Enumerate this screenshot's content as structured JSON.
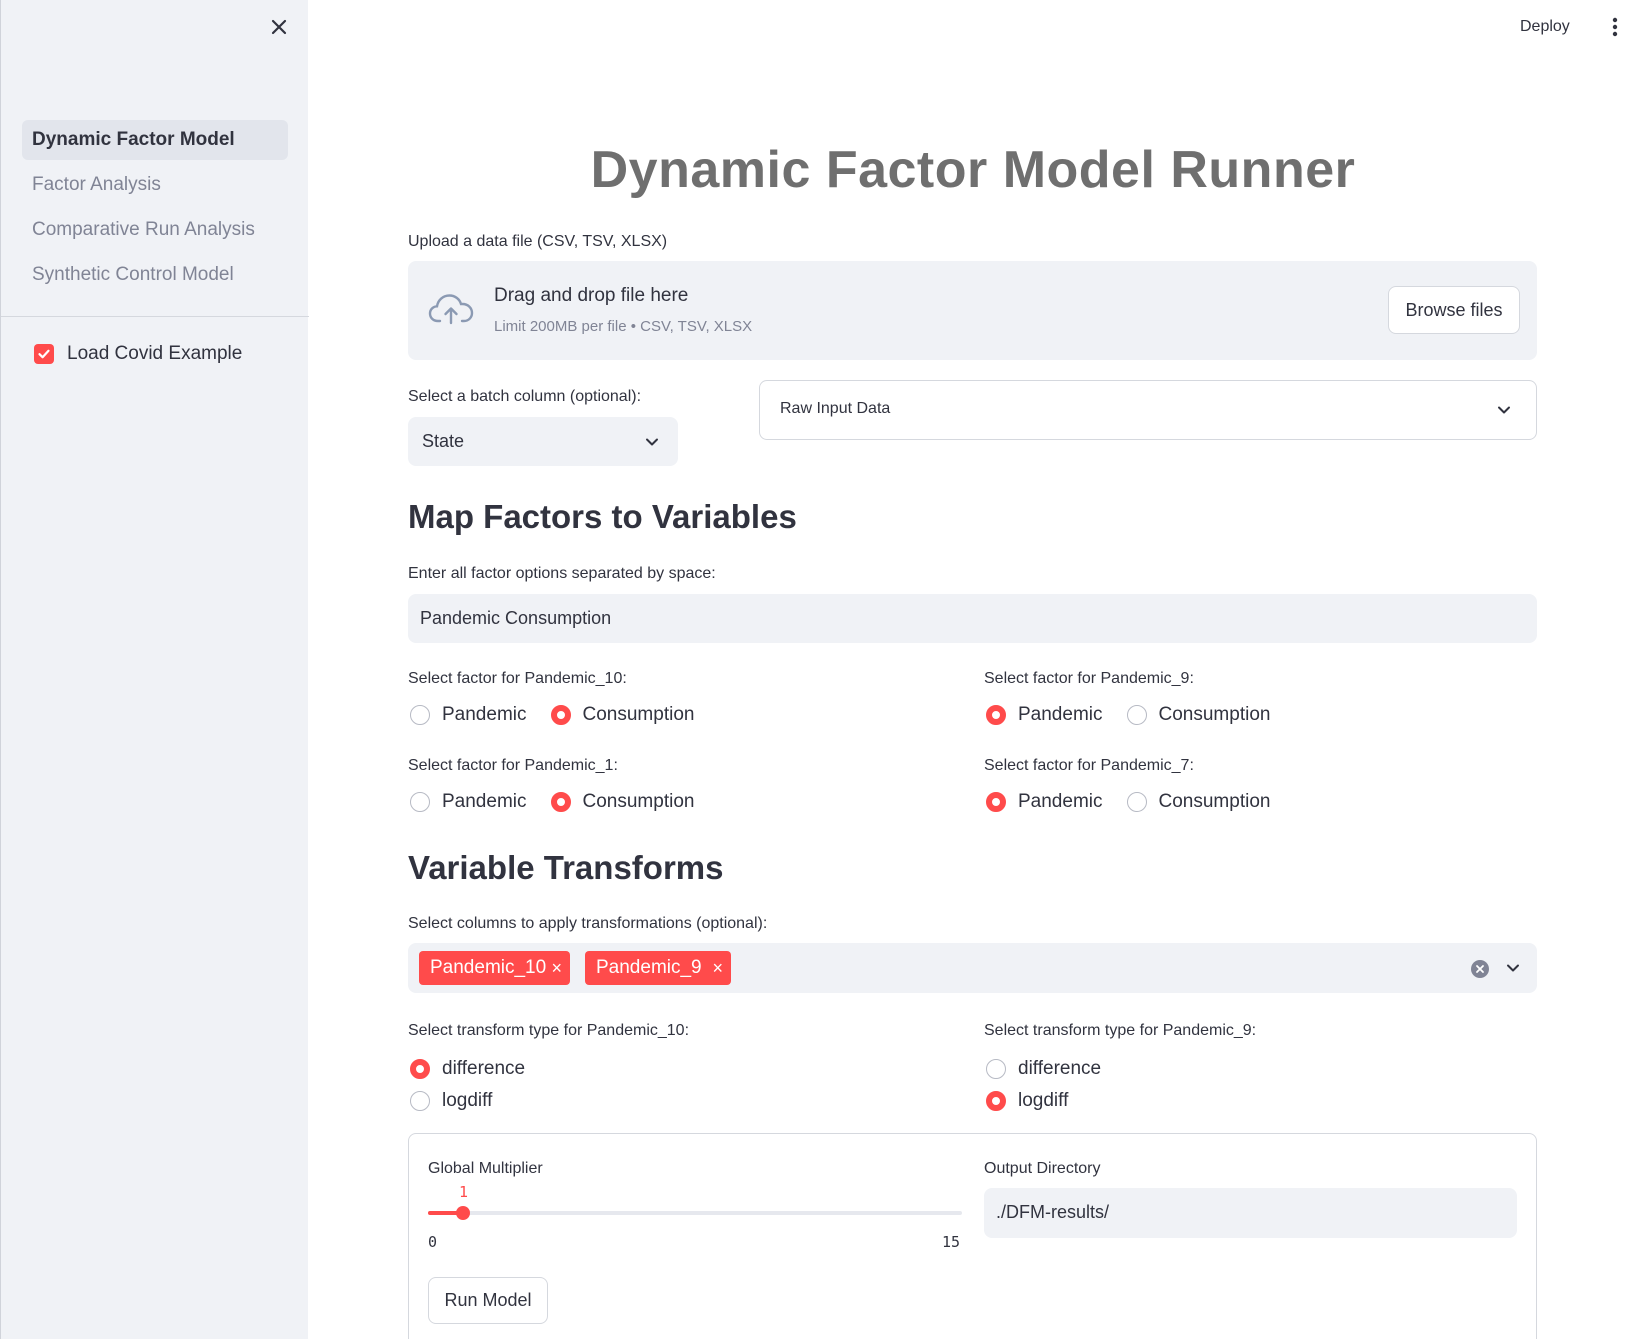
{
  "header": {
    "deploy_label": "Deploy"
  },
  "sidebar": {
    "nav": [
      {
        "label": "Dynamic Factor Model",
        "active": true
      },
      {
        "label": "Factor Analysis"
      },
      {
        "label": "Comparative Run Analysis"
      },
      {
        "label": "Synthetic Control Model"
      }
    ],
    "checkbox": {
      "label": "Load Covid Example",
      "checked": true
    }
  },
  "main": {
    "title": "Dynamic Factor Model Runner",
    "upload": {
      "label": "Upload a data file (CSV, TSV, XLSX)",
      "drop_text": "Drag and drop file here",
      "limit_text": "Limit 200MB per file • CSV, TSV, XLSX",
      "browse_label": "Browse files"
    },
    "batch": {
      "label": "Select a batch column (optional):",
      "value": "State"
    },
    "raw_expander": {
      "label": "Raw Input Data"
    },
    "map_section": {
      "heading": "Map Factors to Variables",
      "factor_input_label": "Enter all factor options separated by space:",
      "factor_input_value": "Pandemic Consumption",
      "groups": [
        {
          "label": "Select factor for Pandemic_10:",
          "options": [
            "Pandemic",
            "Consumption"
          ],
          "selected": "Consumption"
        },
        {
          "label": "Select factor for Pandemic_9:",
          "options": [
            "Pandemic",
            "Consumption"
          ],
          "selected": "Pandemic"
        },
        {
          "label": "Select factor for Pandemic_1:",
          "options": [
            "Pandemic",
            "Consumption"
          ],
          "selected": "Consumption"
        },
        {
          "label": "Select factor for Pandemic_7:",
          "options": [
            "Pandemic",
            "Consumption"
          ],
          "selected": "Pandemic"
        }
      ]
    },
    "transform_section": {
      "heading": "Variable Transforms",
      "columns_label": "Select columns to apply transformations (optional):",
      "tags": [
        "Pandemic_10",
        "Pandemic_9"
      ],
      "tag_remove_glyph": "×",
      "groups": [
        {
          "label": "Select transform type for Pandemic_10:",
          "options": [
            "difference",
            "logdiff"
          ],
          "selected": "difference"
        },
        {
          "label": "Select transform type for Pandemic_9:",
          "options": [
            "difference",
            "logdiff"
          ],
          "selected": "logdiff"
        }
      ]
    },
    "form": {
      "multiplier_label": "Global Multiplier",
      "multiplier_value": "1",
      "multiplier_min": "0",
      "multiplier_max": "15",
      "output_label": "Output Directory",
      "output_value": "./DFM-results/",
      "run_label": "Run Model"
    }
  },
  "colors": {
    "accent": "#ff4b4b",
    "sidebar_bg": "#f0f2f6",
    "text": "#31333f",
    "muted": "#808495"
  }
}
